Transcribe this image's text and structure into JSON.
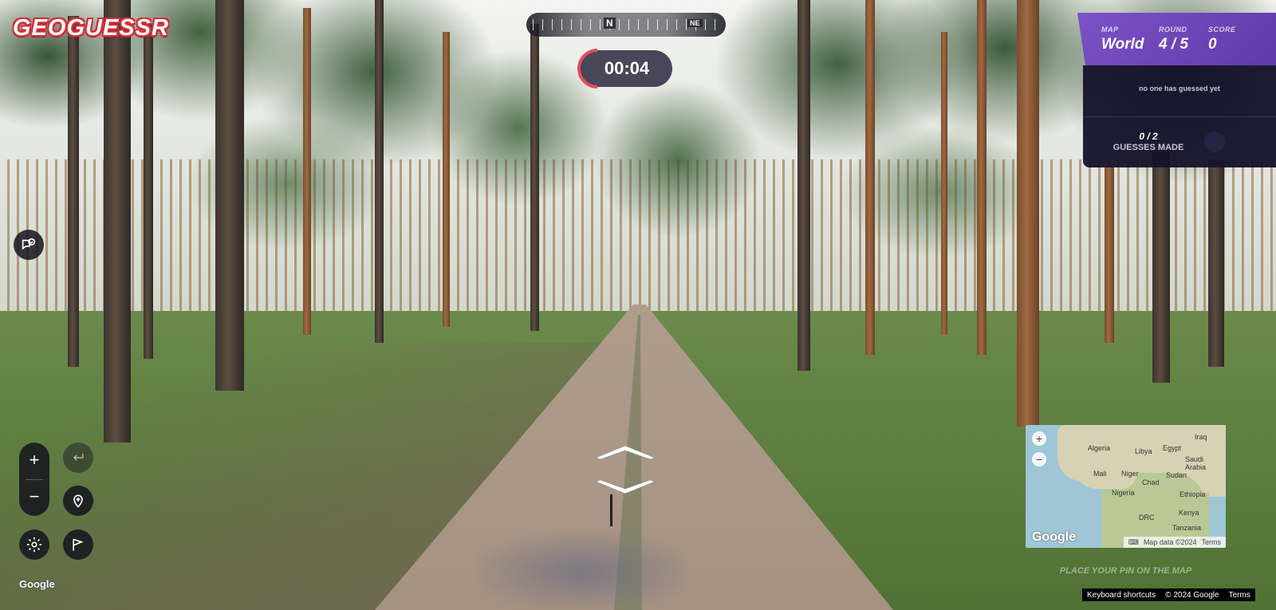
{
  "logo": {
    "text": "GEOGUESSR"
  },
  "compass": {
    "labels": [
      "N",
      "NE"
    ]
  },
  "timer": {
    "time": "00:04"
  },
  "status": {
    "map_label": "MAP",
    "map_value": "World",
    "round_label": "ROUND",
    "round_value": "4 / 5",
    "score_label": "SCORE",
    "score_value": "0",
    "message": "no one has guessed yet",
    "guesses_count": "0 / 2",
    "guesses_label": "GUESSES MADE"
  },
  "controls": {
    "zoom_in": "+",
    "zoom_out": "−",
    "undo_icon": "return-arrow-icon",
    "chat_icon": "chat-icon",
    "pin_icon": "add-pin-icon",
    "settings_icon": "gear-icon",
    "flag_icon": "flag-icon"
  },
  "minimap": {
    "zoom_in": "+",
    "zoom_out": "−",
    "labels": [
      "Iraq",
      "Algeria",
      "Libya",
      "Egypt",
      "Saudi Arabia",
      "Mali",
      "Niger",
      "Chad",
      "Sudan",
      "Nigeria",
      "Ethiopia",
      "Kenya",
      "DRC",
      "Tanzania"
    ],
    "brand": "Google",
    "map_data": "Map data ©2024",
    "terms": "Terms"
  },
  "pin_prompt": "PLACE YOUR PIN ON THE MAP",
  "footer": {
    "brand": "Google",
    "shortcuts": "Keyboard shortcuts",
    "copyright": "© 2024 Google",
    "terms": "Terms"
  },
  "colors": {
    "accent_purple": "#6b45b8",
    "timer_red": "#e54b5c",
    "logo_red": "#d32f3a"
  }
}
